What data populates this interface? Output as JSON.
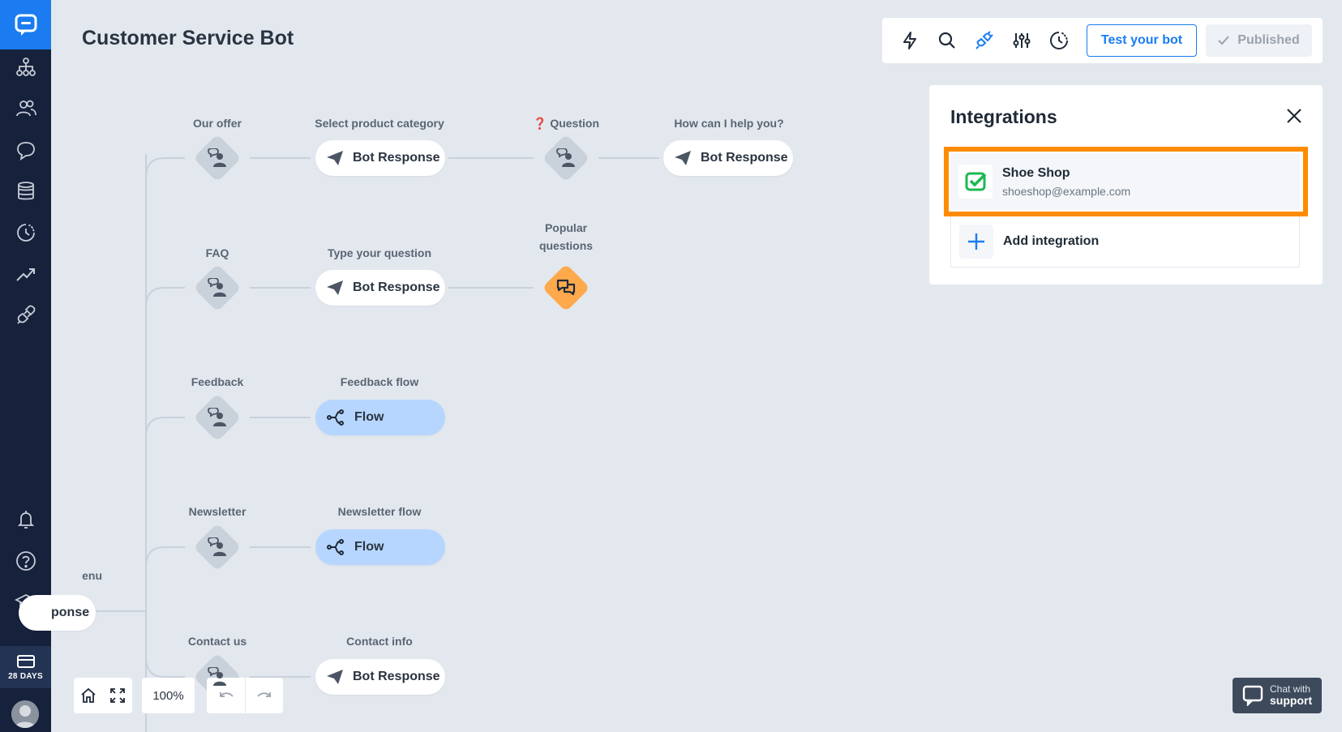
{
  "app": {
    "title": "Customer Service Bot"
  },
  "sidebar": {
    "days_badge": "28 DAYS",
    "items": [
      {
        "icon": "sitemap-icon"
      },
      {
        "icon": "users-icon"
      },
      {
        "icon": "chat-bubble-icon"
      },
      {
        "icon": "database-icon"
      },
      {
        "icon": "history-icon"
      },
      {
        "icon": "trending-up-icon"
      },
      {
        "icon": "plug-icon"
      }
    ],
    "bottom_items": [
      {
        "icon": "bell-icon"
      },
      {
        "icon": "help-circle-icon"
      },
      {
        "icon": "graduation-cap-icon"
      }
    ]
  },
  "toolbar": {
    "test_label": "Test your bot",
    "published_label": "Published",
    "active_icon_color": "#1a7cf0"
  },
  "canvas": {
    "partial_label": "enu",
    "partial_pill": "ponse",
    "rows": [
      {
        "intent_label": "Our offer",
        "response_label": "Select product category",
        "response_text": "Bot Response",
        "extra_intent_label": "Question",
        "extra_intent_prefix": "❓",
        "extra_response_label": "How can I help you?",
        "extra_response_text": "Bot Response"
      },
      {
        "intent_label": "FAQ",
        "response_label": "Type your question",
        "response_text": "Bot Response",
        "popular_label_line1": "Popular",
        "popular_label_line2": "questions"
      },
      {
        "intent_label": "Feedback",
        "response_label": "Feedback flow",
        "response_text": "Flow"
      },
      {
        "intent_label": "Newsletter",
        "response_label": "Newsletter flow",
        "response_text": "Flow"
      },
      {
        "intent_label": "Contact us",
        "response_label": "Contact info",
        "response_text": "Bot Response"
      }
    ]
  },
  "zoom": {
    "level": "100%"
  },
  "integrations": {
    "title": "Integrations",
    "items": [
      {
        "name": "Shoe Shop",
        "email": "shoeshop@example.com"
      }
    ],
    "add_label": "Add integration",
    "highlight_color": "#ff8c00"
  },
  "support": {
    "line1": "Chat with",
    "line2": "support"
  }
}
